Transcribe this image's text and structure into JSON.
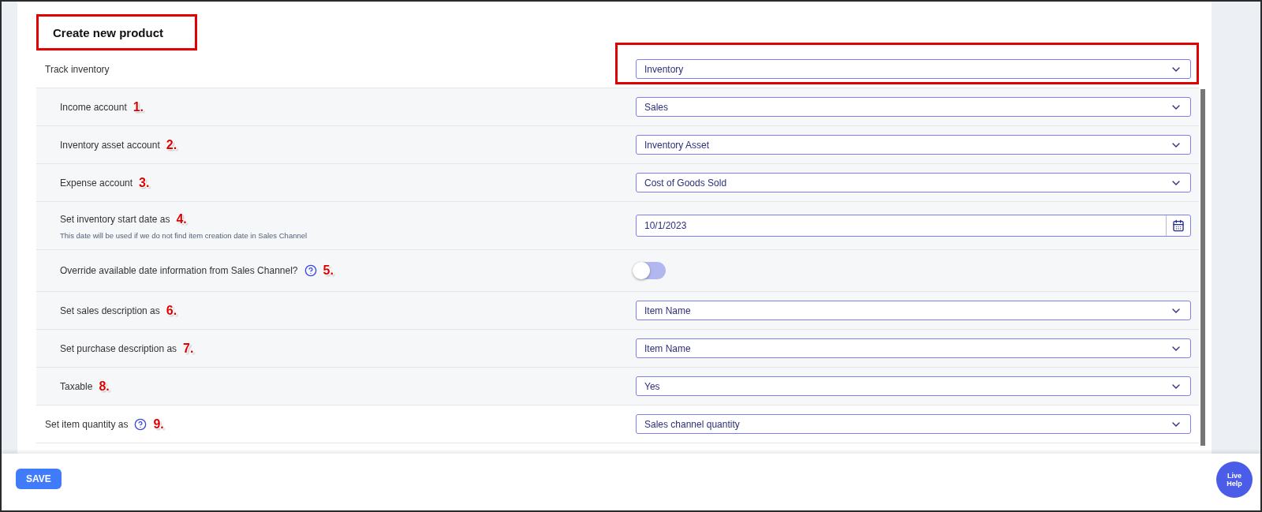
{
  "title": {
    "text": "Create new product",
    "highlighted": true
  },
  "fields": [
    {
      "label": "Track inventory",
      "kind": "select",
      "value": "Inventory",
      "highlighted": true,
      "children": [
        {
          "label": "Income account",
          "marker": "1.",
          "kind": "select",
          "value": "Sales"
        },
        {
          "label": "Inventory asset account",
          "marker": "2.",
          "kind": "select",
          "value": "Inventory Asset"
        },
        {
          "label": "Expense account",
          "marker": "3.",
          "kind": "select",
          "value": "Cost of Goods Sold"
        },
        {
          "label": "Set inventory start date as",
          "marker": "4.",
          "hint": "This date will be used if we do not find item creation date in Sales Channel",
          "kind": "date",
          "value": "10/1/2023"
        },
        {
          "label": "Override available date information from Sales Channel?",
          "help": true,
          "marker": "5.",
          "kind": "toggle",
          "on": false
        },
        {
          "label": "Set sales description as",
          "marker": "6.",
          "kind": "select",
          "value": "Item Name"
        },
        {
          "label": "Set purchase description as",
          "marker": "7.",
          "kind": "select",
          "value": "Item Name"
        },
        {
          "label": "Taxable",
          "marker": "8.",
          "kind": "select",
          "value": "Yes"
        }
      ]
    },
    {
      "label": "Set item quantity as",
      "help": true,
      "marker": "9.",
      "kind": "select",
      "value": "Sales channel quantity"
    }
  ],
  "save_button": "SAVE",
  "live_help": "Live Help"
}
